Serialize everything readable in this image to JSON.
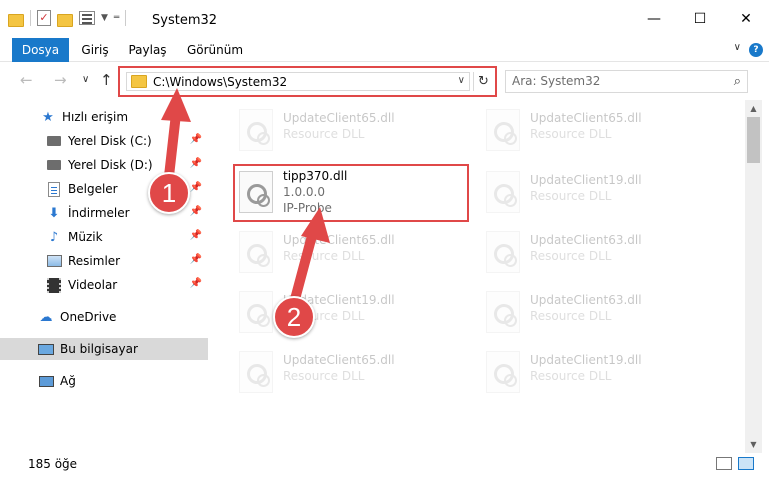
{
  "window": {
    "title": "System32",
    "minimize": "—",
    "maximize": "☐",
    "close": "✕"
  },
  "ribbon": {
    "tabs": [
      {
        "label": "Dosya"
      },
      {
        "label": "Giriş"
      },
      {
        "label": "Paylaş"
      },
      {
        "label": "Görünüm"
      }
    ],
    "help": "?",
    "collapse": "∨"
  },
  "address": {
    "path": "C:\\Windows\\System32",
    "chevron": "∨",
    "refresh": "↻"
  },
  "nav": {
    "back": "←",
    "forward": "→",
    "recent": "∨",
    "up": "↑"
  },
  "search": {
    "placeholder": "Ara: System32",
    "icon": "⌕"
  },
  "sidebar": {
    "items": [
      {
        "label": "Hızlı erişim",
        "icon": "★"
      },
      {
        "label": "Yerel Disk (C:)",
        "pin": "📌"
      },
      {
        "label": "Yerel Disk (D:)",
        "pin": "📌"
      },
      {
        "label": "Belgeler",
        "pin": "📌"
      },
      {
        "label": "İndirmeler",
        "icon": "⬇",
        "pin": "📌"
      },
      {
        "label": "Müzik",
        "icon": "♪",
        "pin": "📌"
      },
      {
        "label": "Resimler",
        "pin": "📌"
      },
      {
        "label": "Videolar",
        "pin": "📌"
      },
      {
        "label": "OneDrive",
        "icon": "☁"
      },
      {
        "label": "Bu bilgisayar"
      },
      {
        "label": "Ağ"
      }
    ]
  },
  "files": {
    "left": [
      {
        "name": "UpdateClient65.dll",
        "sub1": "Resource DLL"
      },
      {
        "name": "tipp370.dll",
        "sub1": "1.0.0.0",
        "sub2": "IP-Probe"
      },
      {
        "name": "UpdateClient65.dll",
        "sub1": "Resource DLL"
      },
      {
        "name": "UpdateClient19.dll",
        "sub1": "Resource DLL"
      },
      {
        "name": "UpdateClient65.dll",
        "sub1": "Resource DLL"
      }
    ],
    "right": [
      {
        "name": "UpdateClient65.dll",
        "sub1": "Resource DLL"
      },
      {
        "name": "UpdateClient19.dll",
        "sub1": "Resource DLL"
      },
      {
        "name": "UpdateClient63.dll",
        "sub1": "Resource DLL"
      },
      {
        "name": "UpdateClient63.dll",
        "sub1": "Resource DLL"
      },
      {
        "name": "UpdateClient19.dll",
        "sub1": "Resource DLL"
      }
    ]
  },
  "status": {
    "count": "185 öğe"
  },
  "annotations": {
    "step1": "1",
    "step2": "2"
  },
  "colors": {
    "accent": "#1979ca",
    "highlight": "#e04848"
  }
}
